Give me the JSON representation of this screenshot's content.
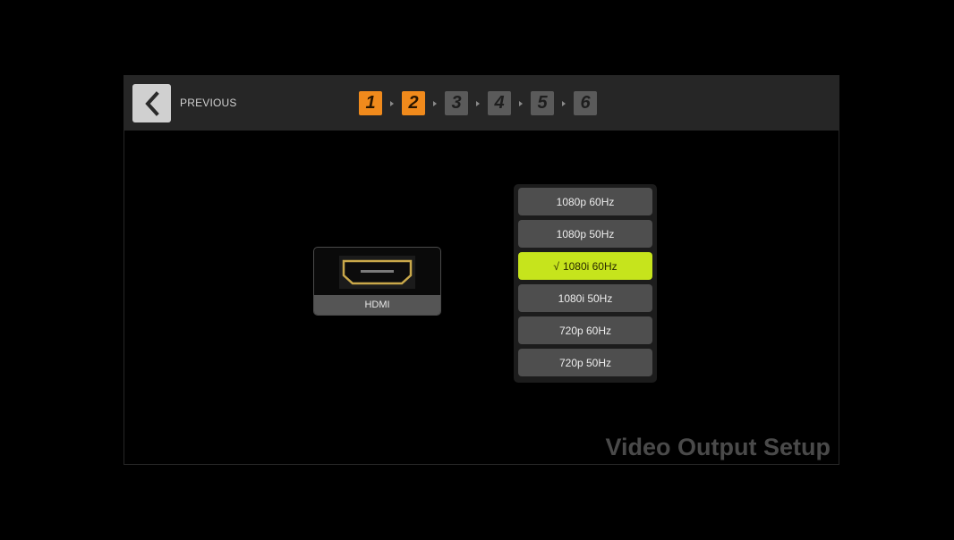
{
  "nav": {
    "previous_label": "PREVIOUS",
    "steps": [
      {
        "label": "1",
        "state": "completed"
      },
      {
        "label": "2",
        "state": "current"
      },
      {
        "label": "3",
        "state": "pending"
      },
      {
        "label": "4",
        "state": "pending"
      },
      {
        "label": "5",
        "state": "pending"
      },
      {
        "label": "6",
        "state": "pending"
      }
    ]
  },
  "output_port": {
    "icon": "hdmi-port-icon",
    "label": "HDMI"
  },
  "resolutions": {
    "options": [
      {
        "label": "1080p 60Hz",
        "selected": false
      },
      {
        "label": "1080p 50Hz",
        "selected": false
      },
      {
        "label": "1080i 60Hz",
        "selected": true
      },
      {
        "label": "1080i 50Hz",
        "selected": false
      },
      {
        "label": "720p 60Hz",
        "selected": false
      },
      {
        "label": "720p 50Hz",
        "selected": false
      }
    ],
    "check_mark": "√"
  },
  "page_title": "Video Output Setup",
  "colors": {
    "step_active": "#f08a1c",
    "step_inactive": "#5a5a5a",
    "selected_option": "#c6e41c",
    "hdmi_gold": "#c9a84a"
  }
}
